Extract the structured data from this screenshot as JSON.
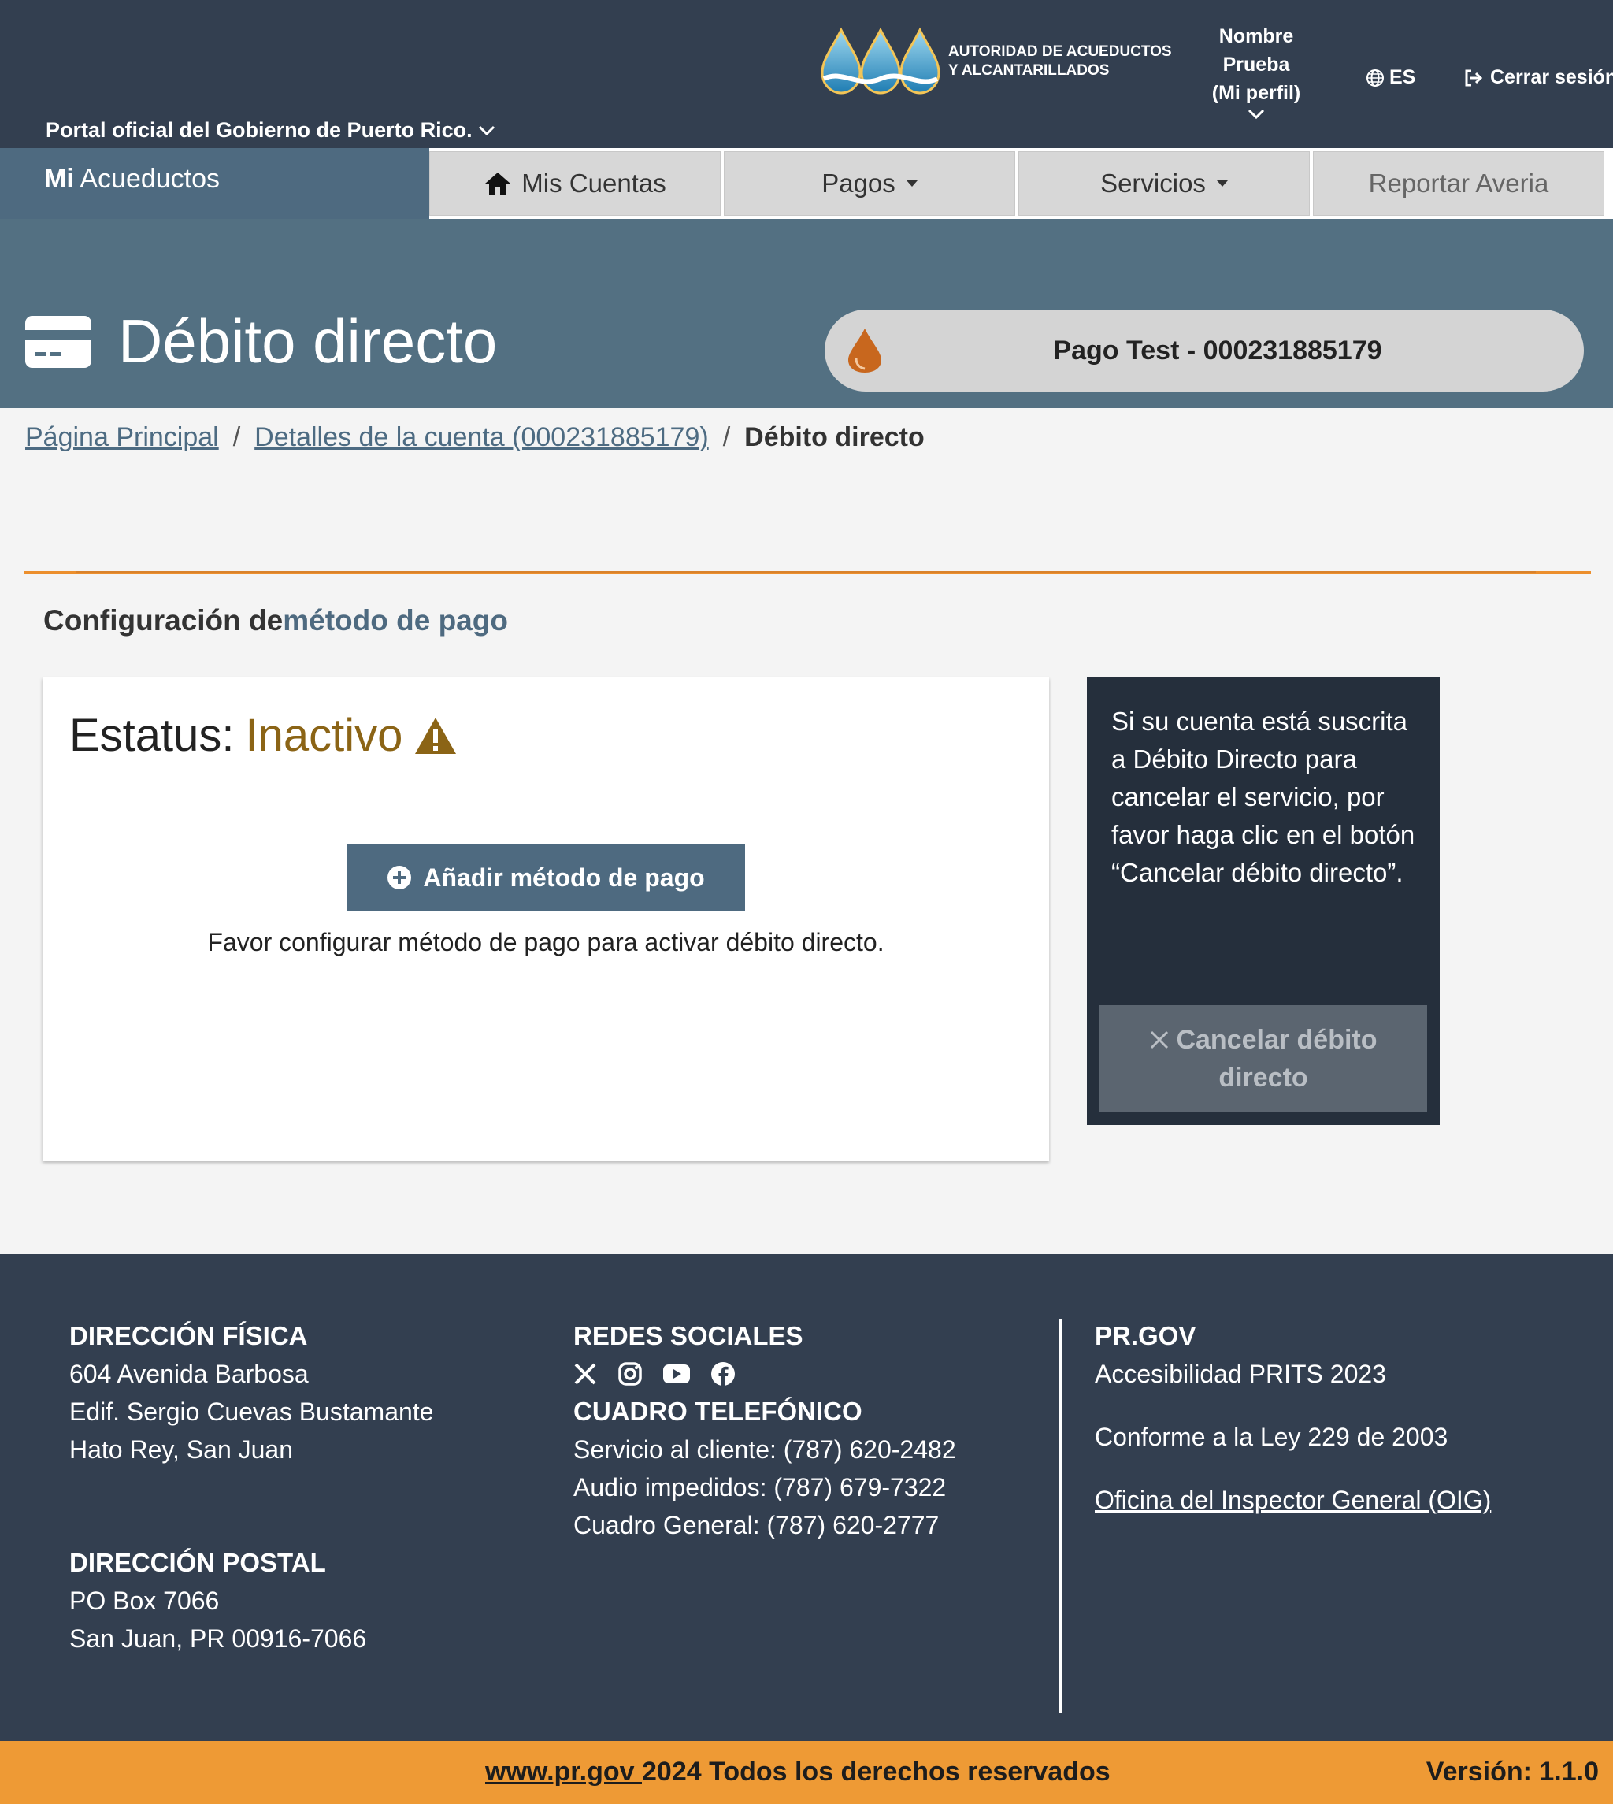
{
  "topbar": {
    "gov_link": "Portal oficial del Gobierno de Puerto Rico.",
    "logo_line1": "AUTORIDAD DE ACUEDUCTOS",
    "logo_line2": "Y ALCANTARILLADOS",
    "profile_line1": "Nombre",
    "profile_line2": "Prueba",
    "profile_line3": "(Mi perfil)",
    "language": "ES",
    "logout": "Cerrar sesión"
  },
  "brand": {
    "mi": "Mi",
    "name": "Acueductos"
  },
  "nav": {
    "items": [
      {
        "label": "Mis Cuentas"
      },
      {
        "label": "Pagos"
      },
      {
        "label": "Servicios"
      },
      {
        "label": "Reportar Averia"
      }
    ]
  },
  "header": {
    "title": "Débito directo",
    "account": "Pago Test - 000231885179"
  },
  "breadcrumb": {
    "home": "Página Principal",
    "account": "Detalles de la cuenta (000231885179)",
    "current": "Débito directo",
    "separator": "/"
  },
  "section": {
    "title_prefix": "Configuración de",
    "title_bold": "método de pago"
  },
  "status_card": {
    "label": "Estatus:",
    "value": "Inactivo",
    "add_button": "Añadir método de pago",
    "hint": "Favor configurar método de pago para activar débito directo."
  },
  "info_card": {
    "text": "Si su cuenta está suscrita a Débito Directo para cancelar el servicio, por favor haga clic en el botón “Cancelar débito directo”.",
    "cancel_button": "Cancelar débito directo"
  },
  "footer": {
    "physical": {
      "heading": "DIRECCIÓN FÍSICA",
      "line1": "604 Avenida Barbosa",
      "line2": "Edif. Sergio Cuevas Bustamante",
      "line3": "Hato Rey, San Juan"
    },
    "postal": {
      "heading": "DIRECCIÓN POSTAL",
      "line1": "PO Box 7066",
      "line2": "San Juan, PR 00916-7066"
    },
    "social": {
      "heading": "REDES SOCIALES",
      "icons": [
        "x-icon",
        "instagram-icon",
        "youtube-icon",
        "facebook-icon"
      ]
    },
    "phones": {
      "heading": "CUADRO TELEFÓNICO",
      "line1": "Servicio al cliente: (787) 620-2482",
      "line2": "Audio impedidos: (787) 679-7322",
      "line3": "Cuadro General: (787) 620-2777"
    },
    "prgov": {
      "heading": "PR.GOV",
      "line1": "Accesibilidad PRITS 2023",
      "line2": "Conforme a la Ley 229 de 2003",
      "link": "Oficina del Inspector General (OIG)"
    }
  },
  "bottombar": {
    "site_link": "www.pr.gov ",
    "copyright": "2024 Todos los derechos reservados",
    "version": "Versión: 1.1.0"
  },
  "colors": {
    "topbar": "#333f50",
    "header_band": "#537082",
    "accent_orange": "#ec8f2d",
    "status_inactive": "#8b6416",
    "primary_button": "#4e6a80",
    "info_card": "#252f3c"
  }
}
